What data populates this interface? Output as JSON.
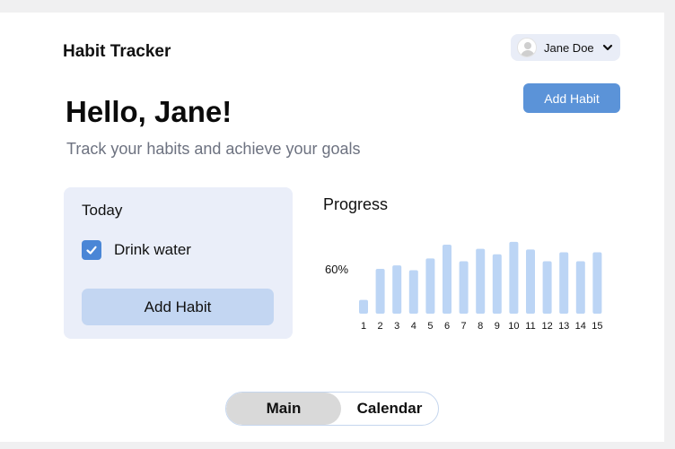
{
  "app": {
    "title": "Habit Tracker"
  },
  "user": {
    "name": "Jane Doe",
    "avatar_icon": "user-avatar-icon"
  },
  "header": {
    "add_habit_label": "Add Habit"
  },
  "hero": {
    "greeting": "Hello, Jane!",
    "subtitle": "Track your habits and achieve your goals"
  },
  "today": {
    "title": "Today",
    "habits": [
      {
        "label": "Drink water",
        "checked": true
      }
    ],
    "add_habit_label": "Add Habit"
  },
  "progress": {
    "title": "Progress",
    "percent_label": "60%"
  },
  "chart_data": {
    "type": "bar",
    "title": "Progress",
    "categories": [
      "1",
      "2",
      "3",
      "4",
      "5",
      "6",
      "7",
      "8",
      "9",
      "10",
      "11",
      "12",
      "13",
      "14",
      "15"
    ],
    "values": [
      0.2,
      0.65,
      0.7,
      0.63,
      0.8,
      1.0,
      0.76,
      0.94,
      0.86,
      1.04,
      0.93,
      0.76,
      0.89,
      0.76,
      0.89
    ],
    "annotation": "60%",
    "grid": false,
    "color": "#bcd5f5"
  },
  "tabs": [
    {
      "label": "Main",
      "active": true
    },
    {
      "label": "Calendar",
      "active": false
    }
  ],
  "colors": {
    "accent": "#5b93d8",
    "card_bg": "#eaeef9",
    "checkbox": "#4a86d6",
    "bar": "#bcd5f5"
  }
}
